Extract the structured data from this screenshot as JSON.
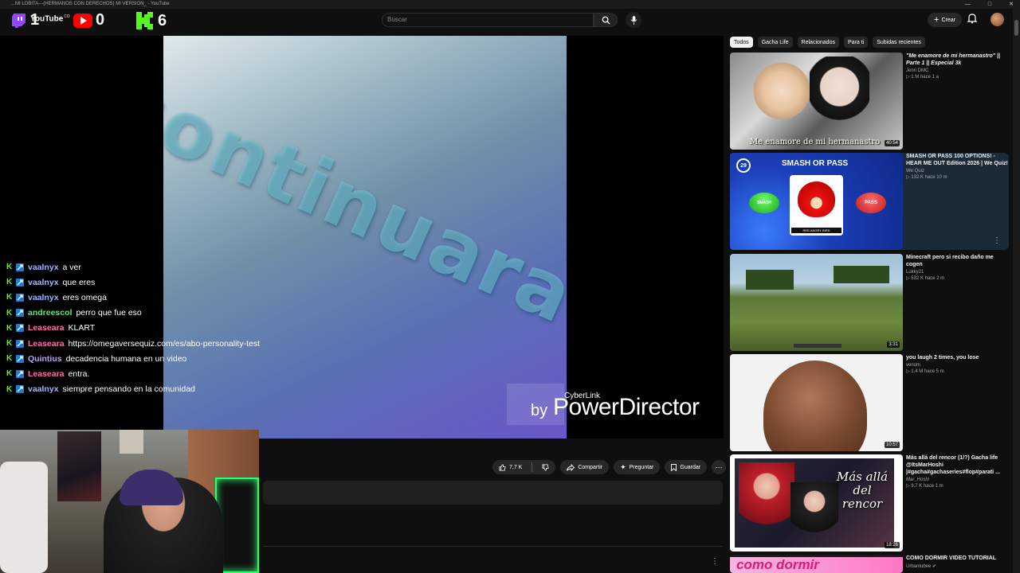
{
  "window": {
    "title": "...MI LOBITA---(HERMANOS CON DERECHOS) MI VERSION_ - YouTube"
  },
  "stream_counters": {
    "twitch": "1",
    "youtube_logo": "YouTube",
    "youtube_country": "CO",
    "youtube": "0",
    "kick": "6"
  },
  "header": {
    "search_placeholder": "Buscar",
    "create_label": "Crear"
  },
  "video": {
    "overlay_text": "continuara",
    "watermark_by": "by",
    "watermark_brand_small": "CyberLink",
    "watermark_brand": "PowerDirector"
  },
  "chat": [
    {
      "platform": "kick",
      "user": "vaalnyx",
      "color": "#9bb5ff",
      "msg": "a ver"
    },
    {
      "platform": "kick",
      "user": "vaalnyx",
      "color": "#9bb5ff",
      "msg": "que eres"
    },
    {
      "platform": "kick",
      "user": "vaalnyx",
      "color": "#9bb5ff",
      "msg": "eres omega"
    },
    {
      "platform": "kick",
      "user": "andreescol",
      "color": "#5ee67a",
      "msg": "perro que fue eso"
    },
    {
      "platform": "kick",
      "user": "Leaseara",
      "color": "#ff6fae",
      "msg": "KLART"
    },
    {
      "platform": "kick",
      "user": "Leaseara",
      "color": "#ff6fae",
      "msg": "https://omegaversequiz.com/es/abo-personality-test"
    },
    {
      "platform": "kick",
      "user": "Quintius",
      "color": "#c49bff",
      "msg": "decadencia humana en un video"
    },
    {
      "platform": "kick",
      "user": "Leaseara",
      "color": "#ff6fae",
      "msg": "entra."
    },
    {
      "platform": "kick",
      "user": "vaalnyx",
      "color": "#9bb5ff",
      "msg": "siempre pensando en la comunidad"
    }
  ],
  "actions": {
    "likes": "7,7 K",
    "share": "Compartir",
    "ask": "Preguntar",
    "save": "Guardar"
  },
  "chips": [
    "Todos",
    "Gacha Life",
    "Relacionados",
    "Para ti",
    "Subidas recientes"
  ],
  "recommendations": [
    {
      "title": "\"Me enamore de mi hermanastro\" || Parte 1 || Especial 3k",
      "channel": "Jenn DMC",
      "meta": "1 M  hace 1 a",
      "duration": "40:54",
      "thumb_caption": "Me enamore de mi hermanastro"
    },
    {
      "title": "SMASH OR PASS 100 OPTIONS! - HEAR ME OUT Edition 2026 | We Quiz!",
      "channel": "We Quiz",
      "meta": "132 K  hace 10 m",
      "duration": "",
      "thumb_caption": "SMASH OR PASS",
      "thumb_badge": "29",
      "thumb_btn_left": "SMASH",
      "thumb_btn_right": "PASS",
      "thumb_card": "RED ANGRY BIRD"
    },
    {
      "title": "Minecraft pero si recibo daño me cogen",
      "channel": "Lukky21",
      "meta": "532 K  hace 2 m",
      "duration": "3:31",
      "thumb_caption": ""
    },
    {
      "title": "you laugh 2 times, you lose",
      "channel": "venom",
      "meta": "1,4 M  hace 5 m",
      "duration": "10:57",
      "thumb_caption": ""
    },
    {
      "title": "Más allá del rencor (1/?) Gacha life @ItsMarHoshi |#gacha#gachaseries#flop#parati ...",
      "channel": "Mar_Hoshi",
      "meta": "9,7 K  hace 1 m",
      "duration": "18:26",
      "thumb_caption": "Más allá del rencor"
    },
    {
      "title": "COMO DORMIR VIDEO TUTORIAL",
      "channel": "Urbantubee",
      "meta": "",
      "duration": "",
      "thumb_caption": "como dormir"
    }
  ]
}
